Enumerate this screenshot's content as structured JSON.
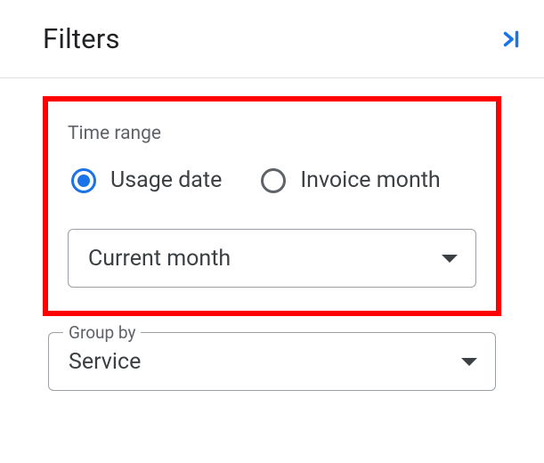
{
  "header": {
    "title": "Filters"
  },
  "timeRange": {
    "sectionLabel": "Time range",
    "options": {
      "usageDate": "Usage date",
      "invoiceMonth": "Invoice month"
    },
    "selected": "usageDate",
    "dropdownValue": "Current month"
  },
  "groupBy": {
    "floatingLabel": "Group by",
    "value": "Service"
  }
}
